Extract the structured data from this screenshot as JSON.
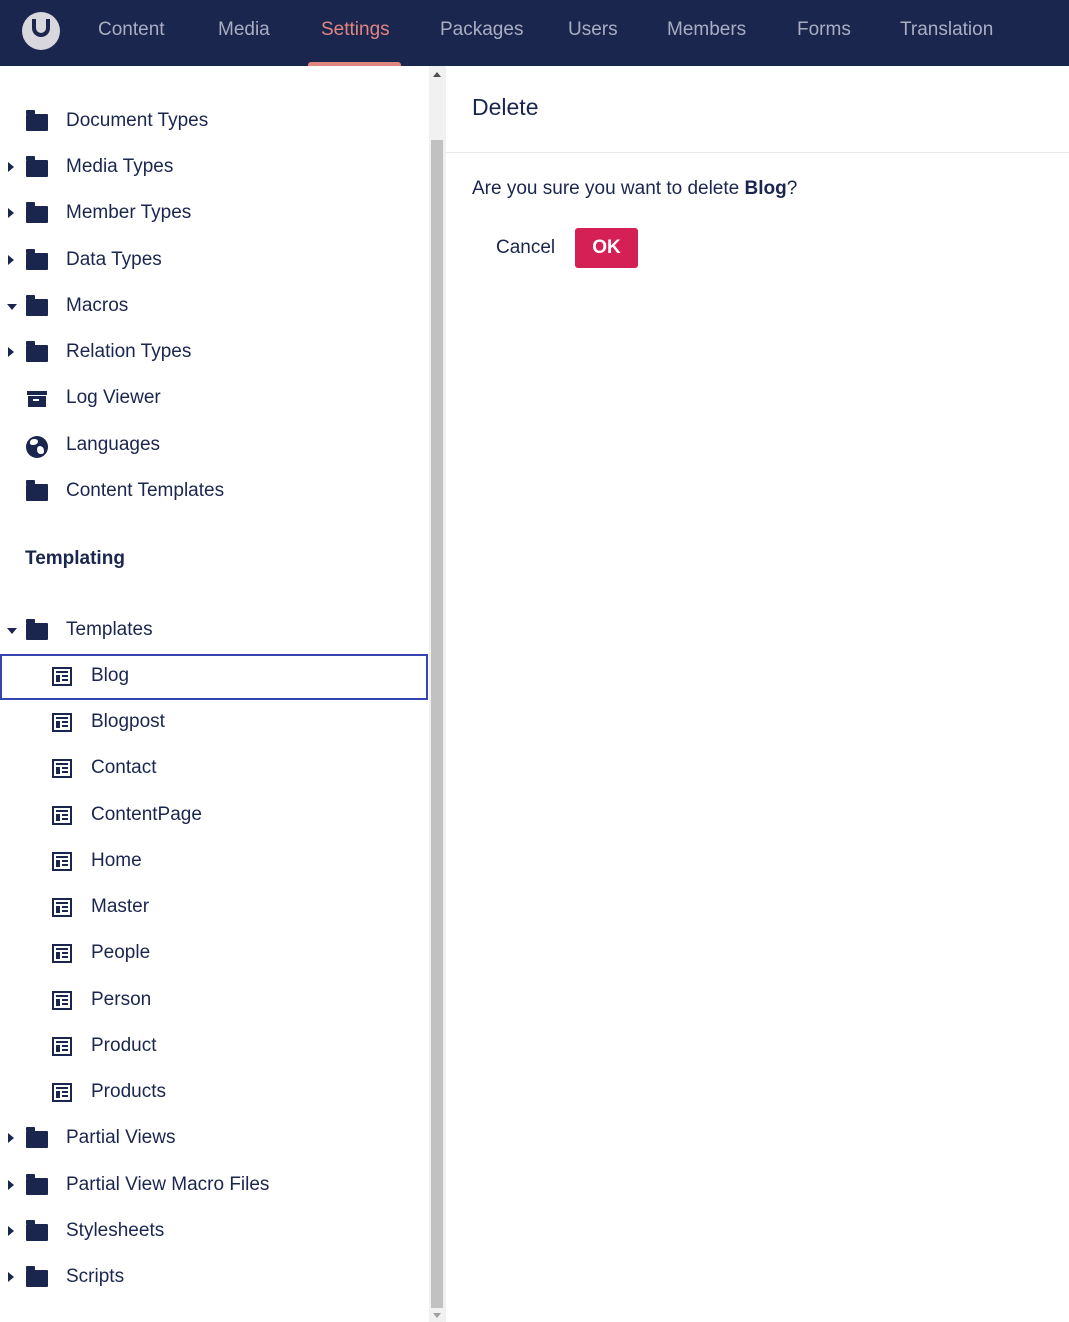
{
  "header": {
    "logo_icon": "umbraco-logo-icon",
    "nav": [
      {
        "label": "Content",
        "active": false
      },
      {
        "label": "Media",
        "active": false
      },
      {
        "label": "Settings",
        "active": true
      },
      {
        "label": "Packages",
        "active": false
      },
      {
        "label": "Users",
        "active": false
      },
      {
        "label": "Members",
        "active": false
      },
      {
        "label": "Forms",
        "active": false
      },
      {
        "label": "Translation",
        "active": false
      }
    ]
  },
  "sidebar": {
    "settings_items": [
      {
        "label": "Document Types",
        "icon": "folder-icon",
        "expander": "none"
      },
      {
        "label": "Media Types",
        "icon": "folder-icon",
        "expander": "collapsed"
      },
      {
        "label": "Member Types",
        "icon": "folder-icon",
        "expander": "collapsed"
      },
      {
        "label": "Data Types",
        "icon": "folder-icon",
        "expander": "collapsed"
      },
      {
        "label": "Macros",
        "icon": "folder-icon",
        "expander": "expanded"
      },
      {
        "label": "Relation Types",
        "icon": "folder-icon",
        "expander": "collapsed"
      },
      {
        "label": "Log Viewer",
        "icon": "archive-icon",
        "expander": "none"
      },
      {
        "label": "Languages",
        "icon": "globe-icon",
        "expander": "none"
      },
      {
        "label": "Content Templates",
        "icon": "folder-icon",
        "expander": "none"
      }
    ],
    "templating_heading": "Templating",
    "templates_folder": {
      "label": "Templates",
      "icon": "folder-icon",
      "expander": "expanded"
    },
    "templates": [
      {
        "label": "Blog",
        "selected": true
      },
      {
        "label": "Blogpost"
      },
      {
        "label": "Contact"
      },
      {
        "label": "ContentPage"
      },
      {
        "label": "Home"
      },
      {
        "label": "Master"
      },
      {
        "label": "People"
      },
      {
        "label": "Person"
      },
      {
        "label": "Product"
      },
      {
        "label": "Products"
      }
    ],
    "templating_items": [
      {
        "label": "Partial Views",
        "icon": "folder-icon",
        "expander": "collapsed"
      },
      {
        "label": "Partial View Macro Files",
        "icon": "folder-icon",
        "expander": "collapsed"
      },
      {
        "label": "Stylesheets",
        "icon": "folder-icon",
        "expander": "collapsed"
      },
      {
        "label": "Scripts",
        "icon": "folder-icon",
        "expander": "collapsed"
      }
    ]
  },
  "dialog": {
    "title": "Delete",
    "question_prefix": "Are you sure you want to delete ",
    "item_name": "Blog",
    "question_suffix": "?",
    "cancel_label": "Cancel",
    "ok_label": "OK"
  },
  "colors": {
    "topbar": "#1b264f",
    "active_nav": "#e0867f",
    "ok_button": "#d42054",
    "selection_outline": "#3544b1"
  }
}
